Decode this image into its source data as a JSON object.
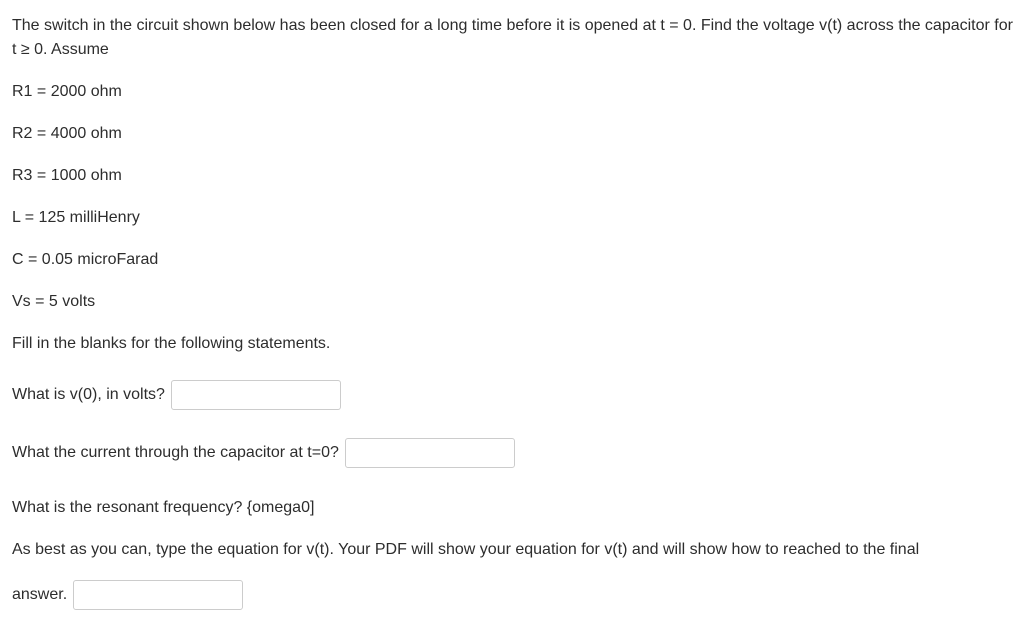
{
  "intro": "The switch in the circuit shown below has been closed for a long time before it is opened at t = 0. Find the voltage v(t) across the capacitor for t ≥ 0. Assume",
  "params": {
    "r1": "R1 = 2000 ohm",
    "r2": "R2 = 4000 ohm",
    "r3": "R3 = 1000 ohm",
    "l": "L = 125 milliHenry",
    "c": "C = 0.05 microFarad",
    "vs": "Vs = 5 volts"
  },
  "fill_instruction": "Fill in the blanks for the following statements.",
  "q1": "What is v(0), in volts?",
  "q2": "What the current through the capacitor at t=0?",
  "q3": "What is the resonant frequency? {omega0]",
  "q4": "As best as you can, type the equation for v(t).  Your PDF will show your equation for v(t) and will show how to reached to the final",
  "answer_label": "answer."
}
